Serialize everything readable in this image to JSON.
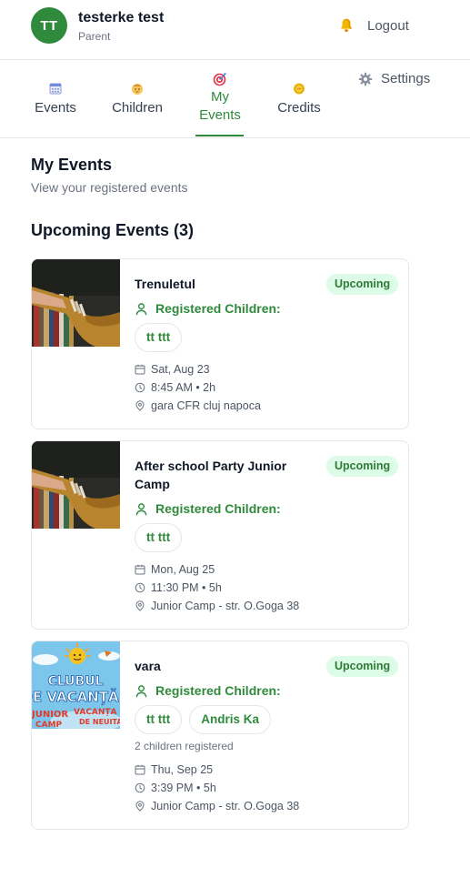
{
  "header": {
    "initials": "TT",
    "name": "testerke test",
    "role": "Parent",
    "logout_label": "Logout",
    "accent": "#2f8a3b"
  },
  "tabs": [
    {
      "label": "Events",
      "icon": "calendar-icon"
    },
    {
      "label": "Children",
      "icon": "baby-icon"
    },
    {
      "label": "My Events",
      "label_line1": "My",
      "label_line2": "Events",
      "icon": "target-icon",
      "active": true
    },
    {
      "label": "Credits",
      "icon": "coin-icon"
    },
    {
      "label": "Settings",
      "icon": "gear-icon"
    }
  ],
  "page": {
    "title": "My Events",
    "subtitle": "View your registered events",
    "section_title": "Upcoming Events (3)"
  },
  "events": [
    {
      "title": "Trenuletul",
      "status": "Upcoming",
      "registered_label": "Registered Children:",
      "children": [
        "tt ttt"
      ],
      "date": "Sat, Aug 23",
      "time": "8:45 AM • 2h",
      "location": "gara CFR cluj napoca",
      "image": "bookshelf-photo"
    },
    {
      "title": "After school Party Junior Camp",
      "status": "Upcoming",
      "registered_label": "Registered Children:",
      "children": [
        "tt ttt"
      ],
      "date": "Mon, Aug 25",
      "time": "11:30 PM • 5h",
      "location": "Junior Camp - str. O.Goga 38",
      "image": "bookshelf-photo"
    },
    {
      "title": "vara",
      "status": "Upcoming",
      "registered_label": "Registered Children:",
      "children": [
        "tt ttt",
        "Andris Ka"
      ],
      "children_count": "2 children registered",
      "date": "Thu, Sep 25",
      "time": "3:39 PM • 5h",
      "location": "Junior Camp - str. O.Goga 38",
      "image": "vacation-club-poster",
      "poster_text": {
        "line1": "CLUBUL",
        "line2": "DE VACANȚĂ",
        "line3": "JUNIOR",
        "line4": "CAMP",
        "line5": "VACANȚA T",
        "line6": "DE NEUITAT"
      }
    }
  ]
}
